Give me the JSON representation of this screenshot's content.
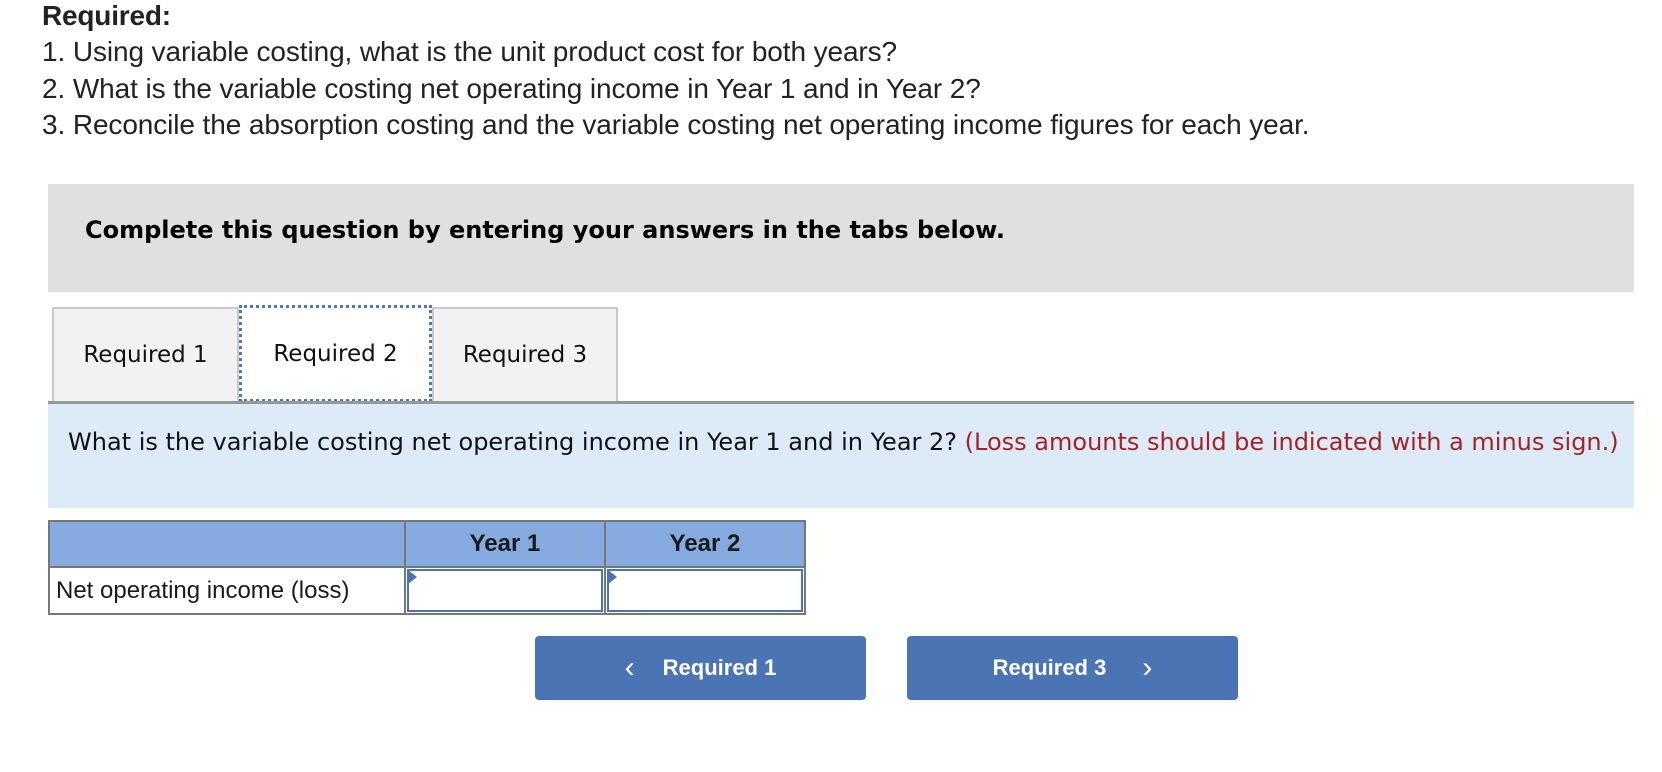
{
  "required": {
    "heading": "Required:",
    "items": [
      "1. Using variable costing, what is the unit product cost for both years?",
      "2. What is the variable costing net operating income in Year 1 and in Year 2?",
      "3. Reconcile the absorption costing and the variable costing net operating income figures for each year."
    ]
  },
  "banner": {
    "text": "Complete this question by entering your answers in the tabs below."
  },
  "tabs": [
    {
      "label": "Required 1",
      "active": false
    },
    {
      "label": "Required 2",
      "active": true
    },
    {
      "label": "Required 3",
      "active": false
    }
  ],
  "instructions": {
    "question": "What is the variable costing net operating income in Year 1 and in Year 2?",
    "note": "(Loss amounts should be indicated with a minus sign.)"
  },
  "table": {
    "headers": [
      "",
      "Year 1",
      "Year 2"
    ],
    "rows": [
      {
        "label": "Net operating income (loss)",
        "values": [
          "",
          ""
        ]
      }
    ]
  },
  "navigation": {
    "prev_label": "Required 1",
    "next_label": "Required 3",
    "prev_icon": "chevron-left-icon",
    "next_icon": "chevron-right-icon"
  },
  "colors": {
    "accent": "#4a74b3",
    "header_fill": "#84aadf",
    "instruction_bg": "#ddeaf8",
    "warning_text": "#a32424",
    "banner_bg": "#e0e0e0"
  }
}
